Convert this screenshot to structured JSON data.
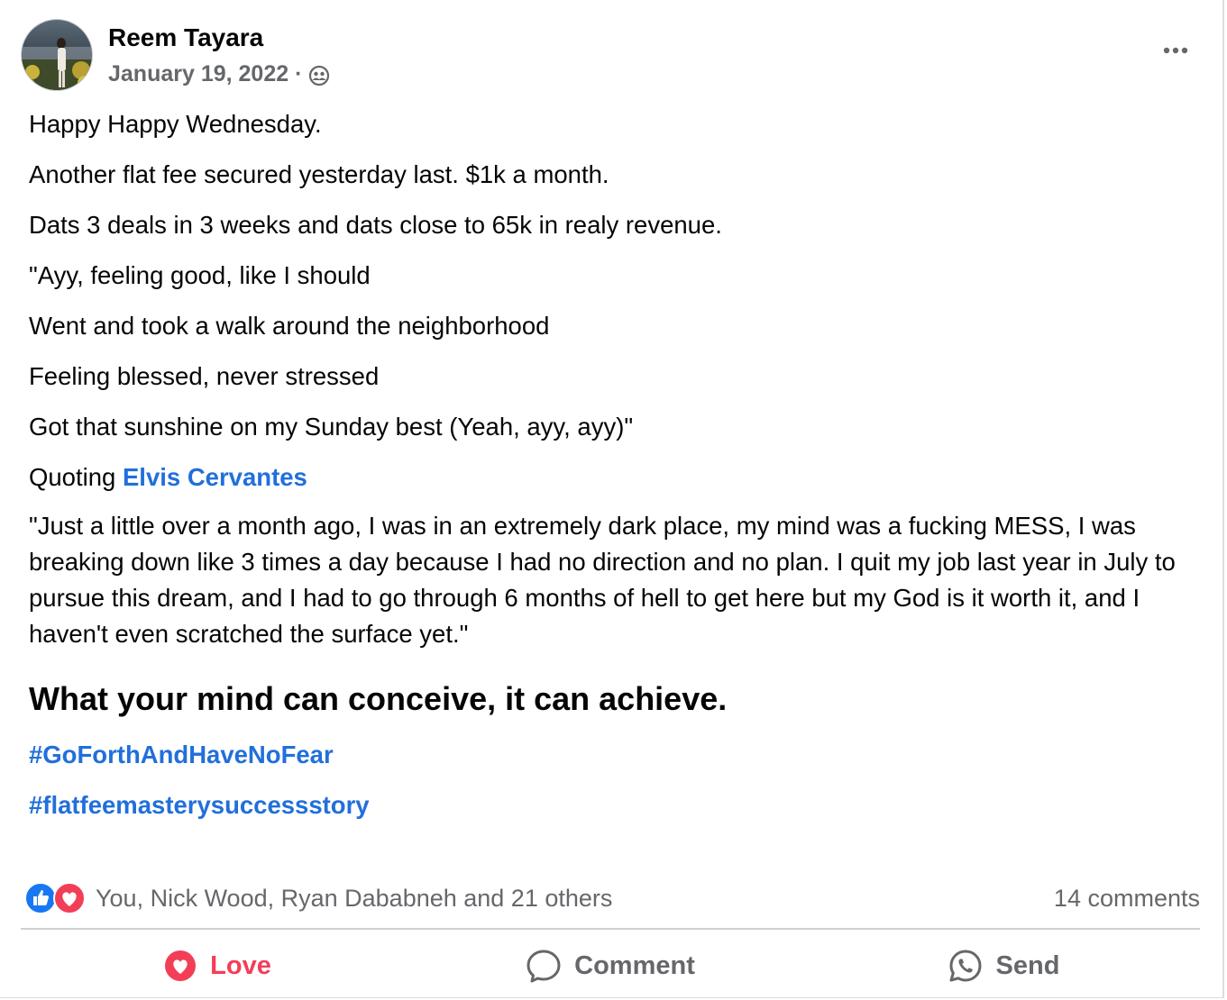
{
  "post": {
    "author": "Reem Tayara",
    "date": "January 19, 2022",
    "separator": "·",
    "audience_icon": "friends-icon",
    "more_icon": "more-dots-icon",
    "paragraphs": [
      "Happy Happy Wednesday.",
      "Another flat fee secured yesterday last. $1k a month.",
      "Dats 3 deals in 3 weeks and dats close to 65k in realy revenue.",
      "\"Ayy, feeling good, like I should",
      "Went and took a walk around the neighborhood",
      "Feeling blessed, never stressed",
      "Got that sunshine on my Sunday best (Yeah, ayy, ayy)\""
    ],
    "quoting_prefix": "Quoting",
    "quoting_name": "Elvis Cervantes",
    "quote": "\"Just a little over a month ago, I was in an extremely dark place, my mind was a fucking MESS, I was breaking down like 3 times a day because I had no direction and no plan. I quit my job last year in July to pursue this dream, and I had to go through 6 months of hell to get here but my God is it worth it, and I haven't even scratched the surface yet.\"",
    "headline": "What your mind can conceive, it can achieve.",
    "hashtags": [
      "#GoForthAndHaveNoFear",
      "#flatfeemasterysuccessstory"
    ]
  },
  "stats": {
    "reactions_text": "You, Nick Wood, Ryan Dababneh and 21 others",
    "reaction_icons": [
      "like-icon",
      "love-icon"
    ],
    "comments_text": "14 comments"
  },
  "actions": {
    "love": "Love",
    "comment": "Comment",
    "send": "Send"
  },
  "colors": {
    "link": "#216fdb",
    "love": "#f33e58",
    "like": "#1877f2",
    "secondary_text": "#65676b"
  }
}
